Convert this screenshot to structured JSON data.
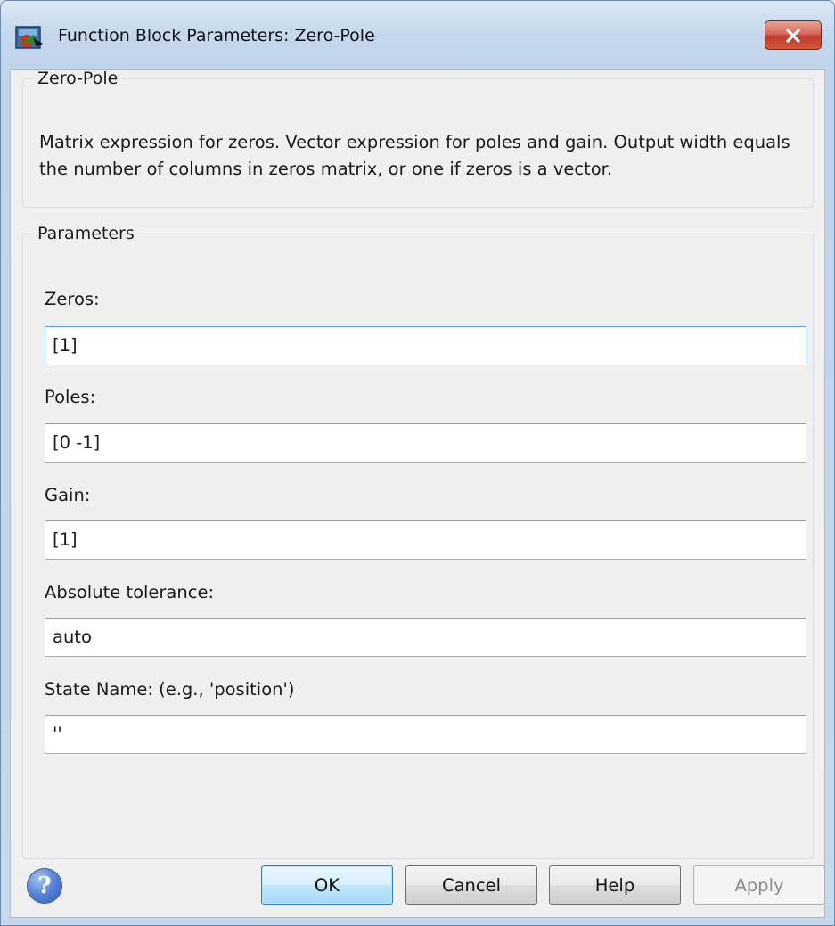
{
  "window": {
    "title": "Function Block Parameters: Zero-Pole",
    "app_icon": "simulink-block-icon",
    "close_icon": "close-icon"
  },
  "block_group": {
    "legend": "Zero-Pole",
    "description": "Matrix expression for zeros.  Vector expression for poles and gain.  Output width equals the number of columns in zeros matrix, or one if zeros is a vector."
  },
  "parameters": {
    "legend": "Parameters",
    "zeros": {
      "label": "Zeros:",
      "value": "[1]"
    },
    "poles": {
      "label": "Poles:",
      "value": "[0 -1]"
    },
    "gain": {
      "label": "Gain:",
      "value": "[1]"
    },
    "absolute_tolerance": {
      "label": "Absolute tolerance:",
      "value": "auto"
    },
    "state_name": {
      "label": "State Name: (e.g., 'position')",
      "value": "''"
    }
  },
  "buttons": {
    "help_icon": "?",
    "ok": "OK",
    "cancel": "Cancel",
    "help": "Help",
    "apply": "Apply"
  },
  "colors": {
    "focus_border": "#569de5",
    "default_button": "#bee6fd",
    "close_button": "#c13a2a"
  }
}
